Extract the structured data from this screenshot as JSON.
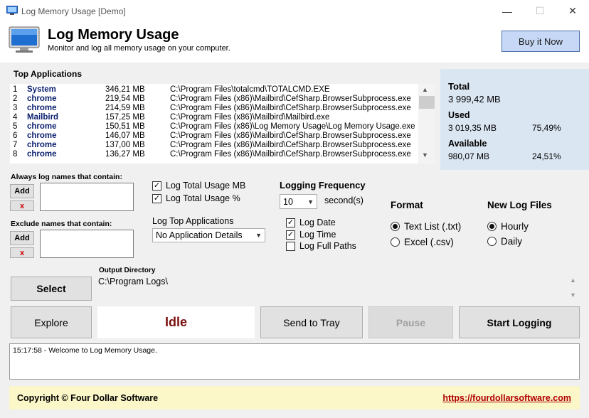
{
  "window": {
    "title": "Log Memory Usage [Demo]",
    "minimize_glyph": "—",
    "maximize_glyph": "☐",
    "close_glyph": "✕"
  },
  "header": {
    "title": "Log Memory Usage",
    "subtitle": "Monitor and log all memory usage on your computer.",
    "buy_label": "Buy it Now"
  },
  "top_apps": {
    "label": "Top Applications",
    "rows": [
      {
        "idx": "1",
        "name": "System",
        "mem": "346,21 MB",
        "path": "C:\\Program Files\\totalcmd\\TOTALCMD.EXE"
      },
      {
        "idx": "2",
        "name": "chrome",
        "mem": "219,54 MB",
        "path": "C:\\Program Files (x86)\\Mailbird\\CefSharp.BrowserSubprocess.exe"
      },
      {
        "idx": "3",
        "name": "chrome",
        "mem": "214,59 MB",
        "path": "C:\\Program Files (x86)\\Mailbird\\CefSharp.BrowserSubprocess.exe"
      },
      {
        "idx": "4",
        "name": "Mailbird",
        "mem": "157,25 MB",
        "path": "C:\\Program Files (x86)\\Mailbird\\Mailbird.exe"
      },
      {
        "idx": "5",
        "name": "chrome",
        "mem": "150,51 MB",
        "path": "C:\\Program Files (x86)\\Log Memory Usage\\Log Memory Usage.exe"
      },
      {
        "idx": "6",
        "name": "chrome",
        "mem": "146,07 MB",
        "path": "C:\\Program Files (x86)\\Mailbird\\CefSharp.BrowserSubprocess.exe"
      },
      {
        "idx": "7",
        "name": "chrome",
        "mem": "137,00 MB",
        "path": "C:\\Program Files (x86)\\Mailbird\\CefSharp.BrowserSubprocess.exe"
      },
      {
        "idx": "8",
        "name": "chrome",
        "mem": "136,27 MB",
        "path": "C:\\Program Files (x86)\\Mailbird\\CefSharp.BrowserSubprocess.exe"
      }
    ]
  },
  "memory": {
    "total_label": "Total",
    "total_value": "3 999,42 MB",
    "used_label": "Used",
    "used_value": "3 019,35 MB",
    "used_pct": "75,49%",
    "available_label": "Available",
    "available_value": "980,07 MB",
    "available_pct": "24,51%"
  },
  "filters": {
    "include_label": "Always log names that contain:",
    "exclude_label": "Exclude names that contain:",
    "add_label": "Add",
    "remove_label": "x"
  },
  "log_options": {
    "total_mb_label": "Log Total Usage MB",
    "total_mb_checked": true,
    "total_pct_label": "Log Total Usage %",
    "total_pct_checked": true,
    "top_apps_label": "Log Top Applications",
    "top_apps_value": "No Application Details"
  },
  "frequency": {
    "label": "Logging Frequency",
    "value": "10",
    "unit": "second(s)",
    "date_label": "Log Date",
    "date_checked": true,
    "time_label": "Log Time",
    "time_checked": true,
    "paths_label": "Log Full Paths",
    "paths_checked": false
  },
  "format": {
    "label": "Format",
    "txt_label": "Text List (.txt)",
    "csv_label": "Excel (.csv)",
    "selected": "txt"
  },
  "new_log": {
    "label": "New Log Files",
    "hourly_label": "Hourly",
    "daily_label": "Daily",
    "selected": "hourly"
  },
  "output": {
    "select_label": "Select",
    "dir_label": "Output Directory",
    "dir_value": "C:\\Program Logs\\"
  },
  "actions": {
    "explore_label": "Explore",
    "status": "Idle",
    "tray_label": "Send to Tray",
    "pause_label": "Pause",
    "start_label": "Start Logging"
  },
  "log": {
    "message": "15:17:58 - Welcome to Log Memory Usage."
  },
  "footer": {
    "copyright": "Copyright © Four Dollar Software",
    "website": "https://fourdollarsoftware.com"
  },
  "colors": {
    "accent": "#c6d8f5",
    "app_name": "#0a1f6e",
    "status": "#7a1010",
    "link": "#b00000",
    "footer_bg": "#fbf7c8",
    "panel_bg": "#dbe6f3"
  }
}
